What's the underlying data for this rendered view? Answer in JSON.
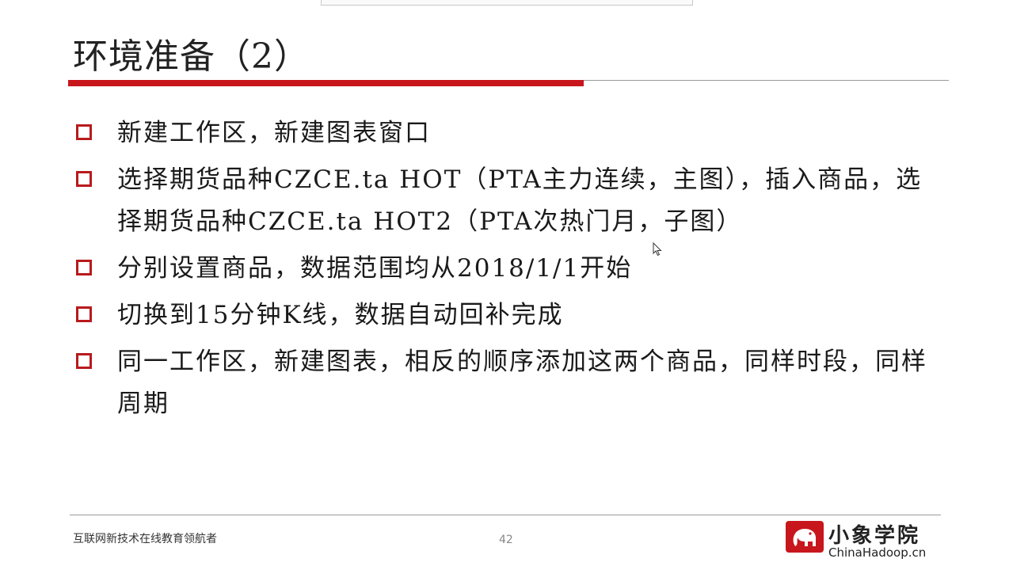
{
  "slide": {
    "title": "环境准备（2）",
    "bullets": [
      "新建工作区，新建图表窗口",
      "选择期货品种CZCE.ta HOT（PTA主力连续，主图），插入商品，选择期货品种CZCE.ta HOT2（PTA次热门月，子图）",
      "分别设置商品，数据范围均从2018/1/1开始",
      "切换到15分钟K线，数据自动回补完成",
      "同一工作区，新建图表，相反的顺序添加这两个商品，同样时段，同样周期"
    ]
  },
  "footer": {
    "tagline": "互联网新技术在线教育领航者",
    "page_number": "42",
    "logo_name": "小象学院",
    "logo_domain": "ChinaHadoop.cn",
    "logo_icon": "elephant-icon"
  },
  "colors": {
    "accent_red": "#c8161d",
    "rule_gray": "#9a9a9a",
    "text": "#1a1a1a"
  }
}
